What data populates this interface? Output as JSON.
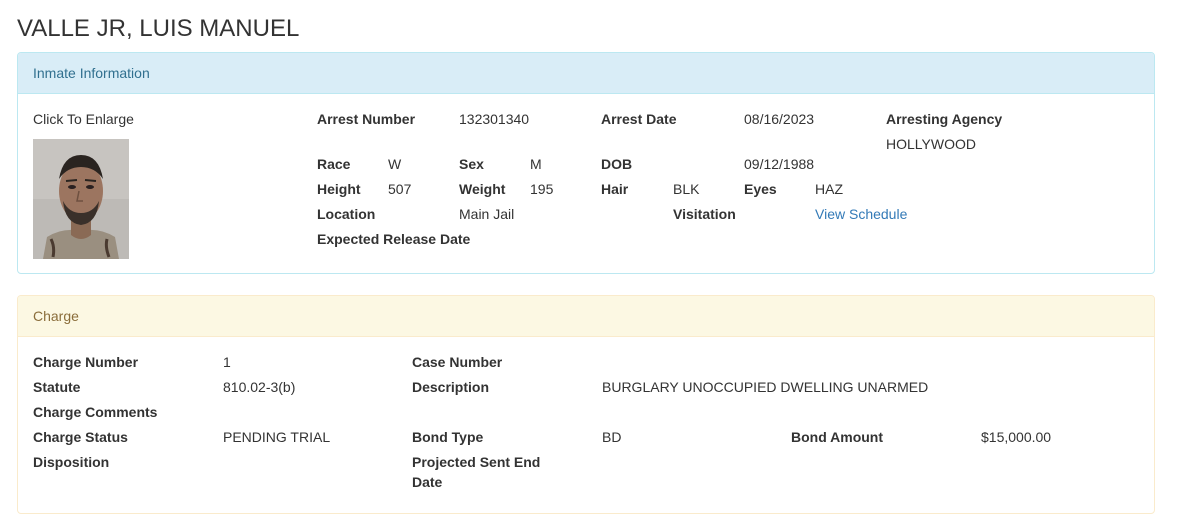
{
  "page": {
    "title": "VALLE JR, LUIS MANUEL"
  },
  "inmate": {
    "heading": "Inmate Information",
    "enlarge_label": "Click To Enlarge",
    "arrest_number_label": "Arrest Number",
    "arrest_number": "132301340",
    "arrest_date_label": "Arrest Date",
    "arrest_date": "08/16/2023",
    "arresting_agency_label": "Arresting Agency",
    "arresting_agency": "HOLLYWOOD",
    "race_label": "Race",
    "race": "W",
    "sex_label": "Sex",
    "sex": "M",
    "dob_label": "DOB",
    "dob": "09/12/1988",
    "height_label": "Height",
    "height": "507",
    "weight_label": "Weight",
    "weight": "195",
    "hair_label": "Hair",
    "hair": "BLK",
    "eyes_label": "Eyes",
    "eyes": "HAZ",
    "location_label": "Location",
    "location": "Main Jail",
    "visitation_label": "Visitation",
    "visitation_link": "View Schedule",
    "expected_release_label": "Expected Release Date",
    "photo_icon": "mugshot-photo"
  },
  "charge": {
    "heading": "Charge",
    "charge_number_label": "Charge Number",
    "charge_number": "1",
    "case_number_label": "Case Number",
    "statute_label": "Statute",
    "statute": "810.02-3(b)",
    "description_label": "Description",
    "description": "BURGLARY UNOCCUPIED DWELLING UNARMED",
    "comments_label": "Charge Comments",
    "status_label": "Charge Status",
    "status": "PENDING TRIAL",
    "bond_type_label": "Bond Type",
    "bond_type": "BD",
    "bond_amount_label": "Bond Amount",
    "bond_amount": "$15,000.00",
    "disposition_label": "Disposition",
    "projected_label_line1": "Projected Sent End",
    "projected_label_line2": "Date"
  },
  "colors": {
    "info_bg": "#d9edf7",
    "info_text": "#31708f",
    "warn_bg": "#fcf8e3",
    "warn_text": "#8a6d3b",
    "link": "#337ab7"
  }
}
